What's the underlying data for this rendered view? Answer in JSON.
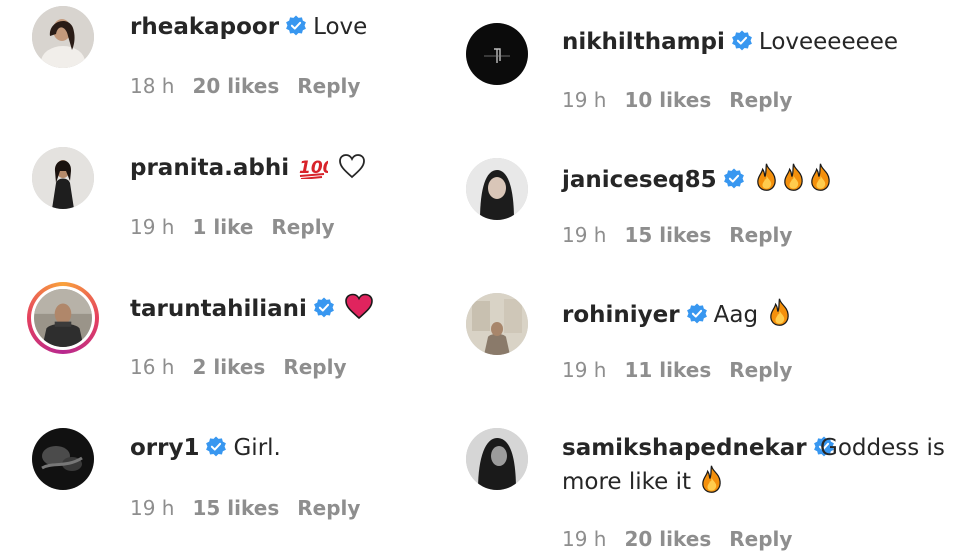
{
  "comments_left": [
    {
      "username": "rheakapoor",
      "verified": true,
      "text": "Love",
      "time": "18 h",
      "likes": "20 likes",
      "reply": "Reply"
    },
    {
      "username": "pranita.abhi",
      "verified": false,
      "text": "",
      "time": "19 h",
      "likes": "1 like",
      "reply": "Reply"
    },
    {
      "username": "taruntahiliani",
      "verified": true,
      "text": "",
      "time": "16 h",
      "likes": "2 likes",
      "reply": "Reply"
    },
    {
      "username": "orry1",
      "verified": true,
      "text": "Girl.",
      "time": "19 h",
      "likes": "15 likes",
      "reply": "Reply"
    }
  ],
  "comments_right": [
    {
      "username": "nikhilthampi",
      "verified": true,
      "text": "Loveeeeeee",
      "time": "19 h",
      "likes": "10 likes",
      "reply": "Reply"
    },
    {
      "username": "janiceseq85",
      "verified": true,
      "text": "",
      "time": "19 h",
      "likes": "15 likes",
      "reply": "Reply"
    },
    {
      "username": "rohiniyer",
      "verified": true,
      "text": "Aag",
      "time": "19 h",
      "likes": "11 likes",
      "reply": "Reply"
    },
    {
      "username": "samikshapednekar",
      "verified": true,
      "text": "Goddess is more like it",
      "time": "19 h",
      "likes": "20 likes",
      "reply": "Reply"
    }
  ],
  "icons": {
    "verified": "verified-badge-icon",
    "hundred": "hundred-points-emoji",
    "white_heart": "white-heart-emoji",
    "red_heart": "red-heart-emoji",
    "fire": "fire-emoji"
  },
  "colors": {
    "verified_blue": "#3897f0",
    "meta_gray": "#8e8e8e",
    "text": "#262626",
    "heart_red": "#e0245e",
    "fire_orange": "#f4900c"
  }
}
